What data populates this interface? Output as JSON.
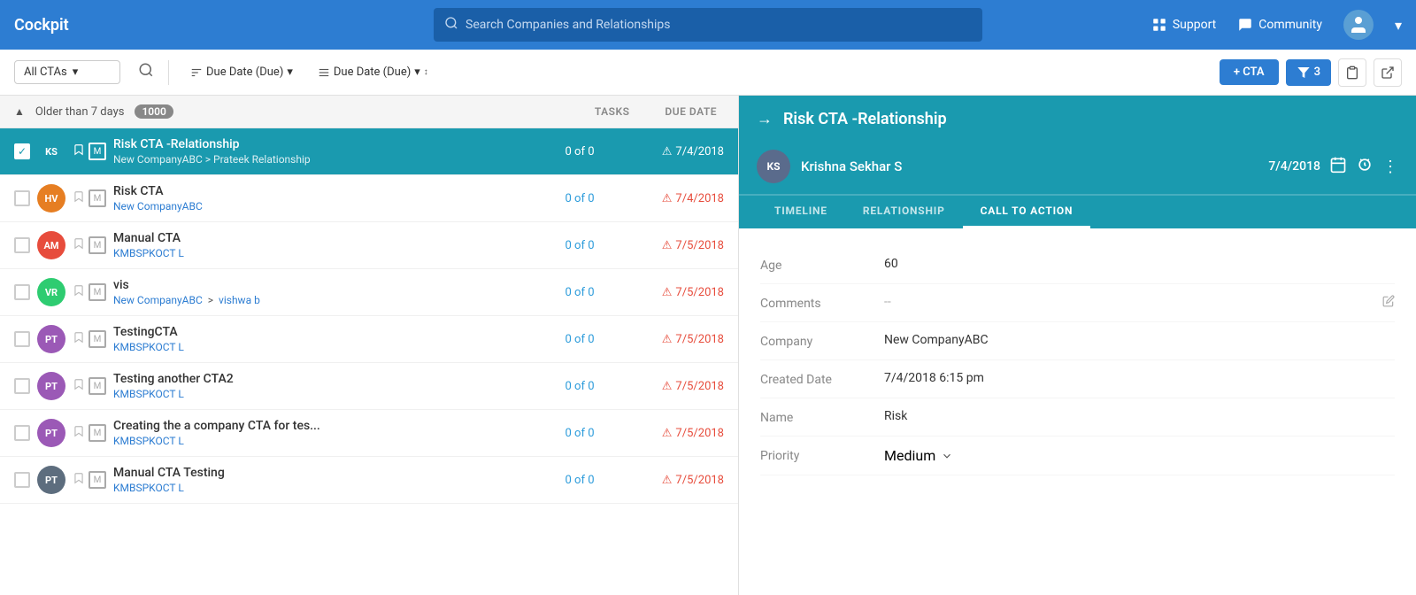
{
  "nav": {
    "logo": "Cockpit",
    "search_placeholder": "Search Companies and Relationships",
    "support_label": "Support",
    "community_label": "Community"
  },
  "toolbar": {
    "filter_label": "All CTAs",
    "sort1_label": "Due Date (Due)",
    "sort2_label": "Due Date (Due)",
    "add_cta_label": "+ CTA",
    "filter_count": "3"
  },
  "list": {
    "group_label": "Older than 7 days",
    "group_count": "1000",
    "col_tasks": "Tasks",
    "col_duedate": "Due Date",
    "rows": [
      {
        "initials": "KS",
        "avatar_color": "#1a9aaf",
        "name": "Risk CTA -Relationship",
        "sub": "New CompanyABC > Prateek Relationship",
        "tasks": "0 of 0",
        "duedate": "7/4/2018",
        "selected": true
      },
      {
        "initials": "HV",
        "avatar_color": "#e67e22",
        "name": "Risk CTA",
        "sub": "New CompanyABC",
        "tasks": "0 of 0",
        "duedate": "7/4/2018",
        "selected": false
      },
      {
        "initials": "AM",
        "avatar_color": "#e74c3c",
        "name": "Manual CTA",
        "sub": "KMBSPKOCT L",
        "tasks": "0 of 0",
        "duedate": "7/5/2018",
        "selected": false
      },
      {
        "initials": "VR",
        "avatar_color": "#2ecc71",
        "name": "vis",
        "sub_prefix": "New CompanyABC",
        "sub_suffix": "vishwa b",
        "has_arrow": true,
        "tasks": "0 of 0",
        "duedate": "7/5/2018",
        "selected": false
      },
      {
        "initials": "PT",
        "avatar_color": "#9b59b6",
        "name": "TestingCTA",
        "sub": "KMBSPKOCT L",
        "tasks": "0 of 0",
        "duedate": "7/5/2018",
        "selected": false
      },
      {
        "initials": "PT",
        "avatar_color": "#9b59b6",
        "name": "Testing another CTA2",
        "sub": "KMBSPKOCT L",
        "tasks": "0 of 0",
        "duedate": "7/5/2018",
        "selected": false
      },
      {
        "initials": "PT",
        "avatar_color": "#9b59b6",
        "name": "Creating the a company CTA for tes...",
        "sub": "KMBSPKOCT L",
        "tasks": "0 of 0",
        "duedate": "7/5/2018",
        "selected": false
      },
      {
        "initials": "PT",
        "avatar_color": "#5d6d7e",
        "name": "Manual CTA Testing",
        "sub": "KMBSPKOCT L",
        "tasks": "0 of 0",
        "duedate": "7/5/2018",
        "selected": false
      }
    ]
  },
  "detail": {
    "title": "Risk CTA -Relationship",
    "avatar_initials": "KS",
    "avatar_color": "#5a6b8c",
    "person_name": "Krishna Sekhar S",
    "date": "7/4/2018",
    "tabs": [
      "TIMELINE",
      "RELATIONSHIP",
      "CALL TO ACTION"
    ],
    "active_tab": "CALL TO ACTION",
    "fields": [
      {
        "label": "Age",
        "value": "60",
        "editable": false
      },
      {
        "label": "Comments",
        "value": "--",
        "editable": true
      },
      {
        "label": "Company",
        "value": "New CompanyABC",
        "editable": false
      },
      {
        "label": "Created Date",
        "value": "7/4/2018 6:15 pm",
        "editable": false
      },
      {
        "label": "Name",
        "value": "Risk",
        "editable": false
      },
      {
        "label": "Priority",
        "value": "Medium",
        "editable": true,
        "has_dropdown": true
      }
    ]
  }
}
